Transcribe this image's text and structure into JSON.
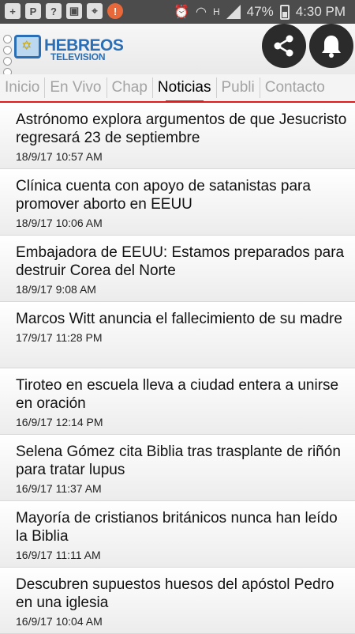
{
  "status_bar": {
    "battery": "47%",
    "time": "4:30 PM",
    "h_label": "H",
    "left_icons": [
      "add-box-icon",
      "p-app-icon",
      "help-icon",
      "image-icon",
      "map-pin-icon",
      "alert-icon"
    ]
  },
  "header": {
    "logo_line1": "HEBREOS",
    "logo_line2": "TELEVISION",
    "share_icon": "share-icon",
    "bell_icon": "bell-icon"
  },
  "tabs": [
    {
      "label": "Inicio",
      "active": false
    },
    {
      "label": "En Vivo",
      "active": false
    },
    {
      "label": "Chap",
      "active": false
    },
    {
      "label": "Noticias",
      "active": true
    },
    {
      "label": "Publi",
      "active": false
    },
    {
      "label": "Contacto",
      "active": false
    }
  ],
  "news": [
    {
      "title": "Astrónomo explora argumentos de que Jesucristo regresará 23 de septiembre",
      "date": "18/9/17 10:57 AM"
    },
    {
      "title": "Clínica cuenta con apoyo de satanistas para promover aborto en EEUU",
      "date": "18/9/17 10:06 AM"
    },
    {
      "title": "Embajadora de EEUU: Estamos preparados para destruir Corea del Norte",
      "date": "18/9/17 9:08 AM"
    },
    {
      "title": "Marcos Witt anuncia el fallecimiento de su madre",
      "date": "17/9/17 11:28 PM"
    },
    {
      "title": "Tiroteo en escuela lleva a ciudad entera a unirse en oración",
      "date": "16/9/17 12:14 PM"
    },
    {
      "title": "Selena Gómez cita Biblia tras trasplante de riñón para tratar lupus",
      "date": "16/9/17 11:37 AM"
    },
    {
      "title": "Mayoría de cristianos británicos nunca han leído la Biblia",
      "date": "16/9/17 11:11 AM"
    },
    {
      "title": "Descubren supuestos huesos del apóstol Pedro en una iglesia",
      "date": "16/9/17 10:04 AM"
    }
  ],
  "colors": {
    "accent": "#e21a1a",
    "brand": "#2a6fb6",
    "status_bar": "#4c4c4c"
  }
}
